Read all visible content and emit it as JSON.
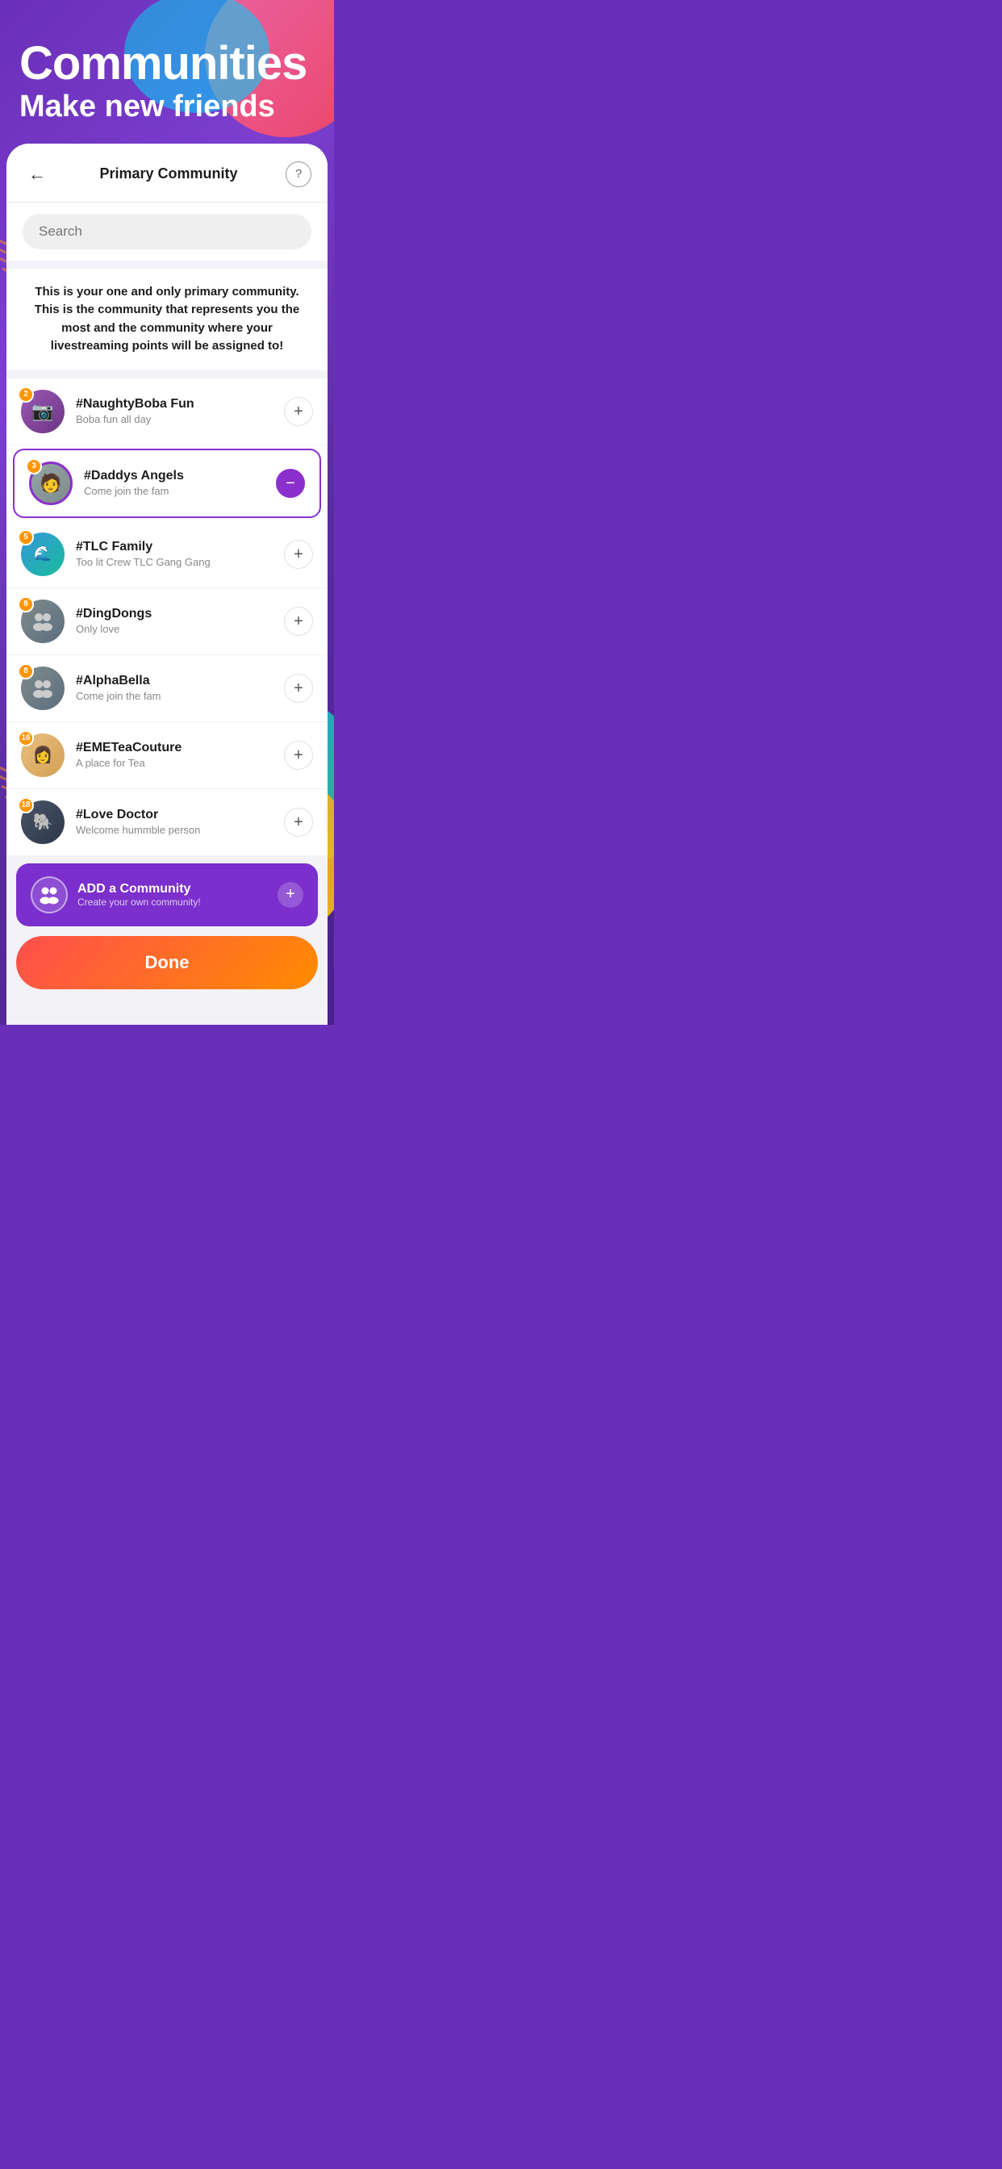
{
  "header": {
    "title": "Communities",
    "subtitle": "Make new friends"
  },
  "card": {
    "title": "Primary Community",
    "back_label": "←",
    "help_label": "?",
    "search_placeholder": "Search",
    "info_text": "This is your one and only primary community. This is the community that represents you the most and the community where your livestreaming points will be assigned to!"
  },
  "communities": [
    {
      "id": "naughty-boba",
      "name": "#NaughtyBoba Fun",
      "description": "Boba fun all day",
      "badge": "2",
      "selected": false,
      "avatar_type": "camera"
    },
    {
      "id": "daddys-angels",
      "name": "#Daddys Angels",
      "description": "Come join the fam",
      "badge": "3",
      "selected": true,
      "avatar_type": "portrait"
    },
    {
      "id": "tlc-family",
      "name": "#TLC Family",
      "description": "Too lit Crew TLC Gang Gang",
      "badge": "5",
      "selected": false,
      "avatar_type": "water"
    },
    {
      "id": "ding-dongs",
      "name": "#DingDongs",
      "description": "Only love",
      "badge": "8",
      "selected": false,
      "avatar_type": "group"
    },
    {
      "id": "alpha-bella",
      "name": "#AlphaBella",
      "description": "Come join the fam",
      "badge": "8",
      "selected": false,
      "avatar_type": "group"
    },
    {
      "id": "eme-tea-couture",
      "name": "#EMETeaCouture",
      "description": "A place for Tea",
      "badge": "16",
      "selected": false,
      "avatar_type": "woman"
    },
    {
      "id": "love-doctor",
      "name": "#Love Doctor",
      "description": "Welcome hummble person",
      "badge": "18",
      "selected": false,
      "avatar_type": "elephant"
    }
  ],
  "add_community": {
    "title": "ADD a Community",
    "subtitle": "Create your own community!",
    "plus_label": "+"
  },
  "done_button": {
    "label": "Done"
  },
  "colors": {
    "accent_purple": "#8b2fcc",
    "done_gradient_start": "#ff4e4e",
    "done_gradient_end": "#ff8c00",
    "badge_color": "#ff9500"
  }
}
